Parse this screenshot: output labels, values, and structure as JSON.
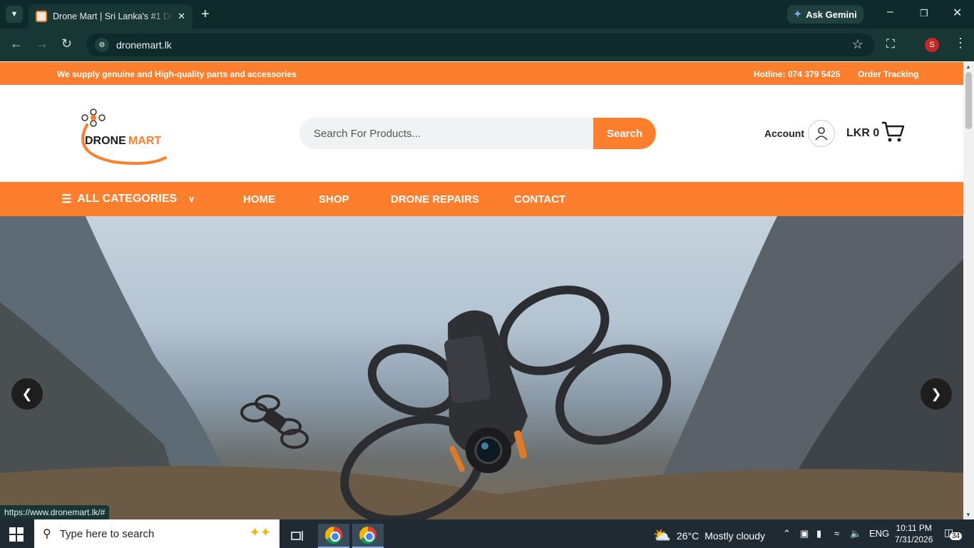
{
  "browser": {
    "tab_title": "Drone Mart | Sri Lanka's #1 Drone Store",
    "url": "dronemart.lk",
    "ask_gemini": "Ask Gemini",
    "profile_initial": "S",
    "status_url": "https://www.dronemart.lk/#"
  },
  "topstrip": {
    "tagline": "We supply genuine and High-quality parts and accessories",
    "hotline": "Hotline: 074 379 5425",
    "order_tracking": "Order Tracking"
  },
  "header": {
    "logo_text": "DRONE MART",
    "search_placeholder": "Search For Products...",
    "search_button": "Search",
    "account_label": "Account",
    "cart_total": "LKR 0"
  },
  "nav": {
    "categories": "ALL CATEGORIES",
    "links": [
      "HOME",
      "SHOP",
      "DRONE REPAIRS",
      "CONTACT"
    ]
  },
  "taskbar": {
    "search_placeholder": "Type here to search",
    "weather_temp": "26°C",
    "weather_desc": "Mostly cloudy",
    "language": "ENG",
    "time": "10:11 PM",
    "date": "7/31/2026",
    "notification_count": "34"
  },
  "colors": {
    "brand_orange": "#fd7e2d",
    "chrome_dark": "#0e2a2a",
    "taskbar": "#1f2a33"
  }
}
